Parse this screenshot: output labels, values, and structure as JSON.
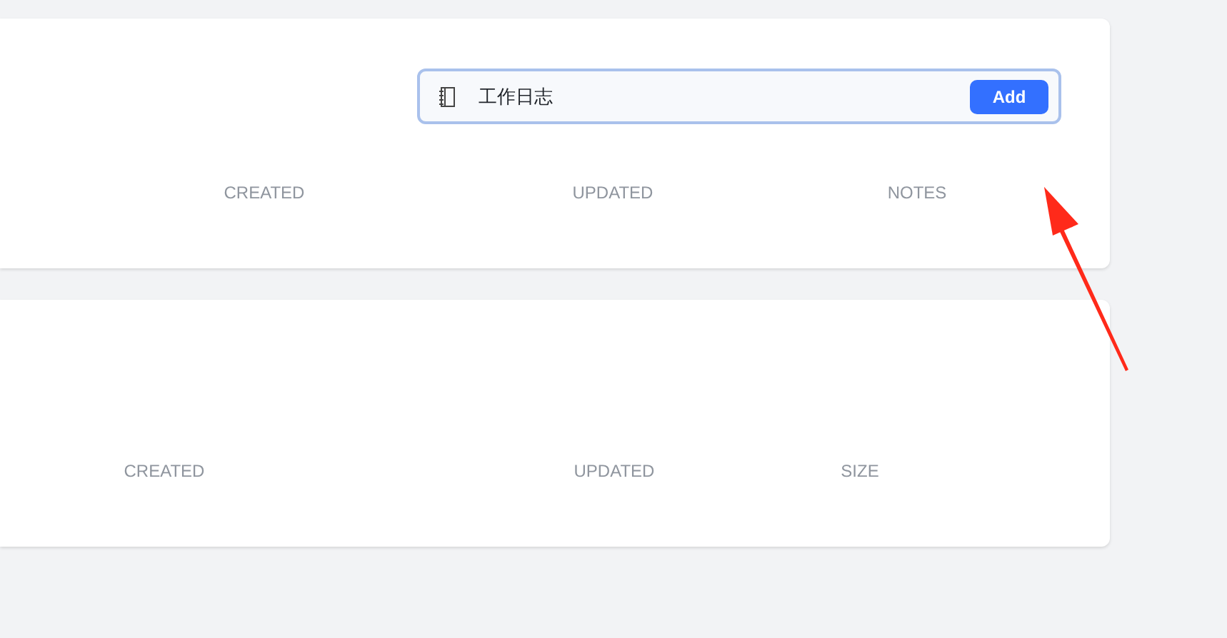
{
  "notebooks_card": {
    "new_notebook_input": {
      "value": "工作日志",
      "button": "Add"
    },
    "columns": [
      "CREATED",
      "UPDATED",
      "NOTES"
    ]
  },
  "files_card": {
    "columns": [
      "CREATED",
      "UPDATED",
      "SIZE"
    ]
  }
}
